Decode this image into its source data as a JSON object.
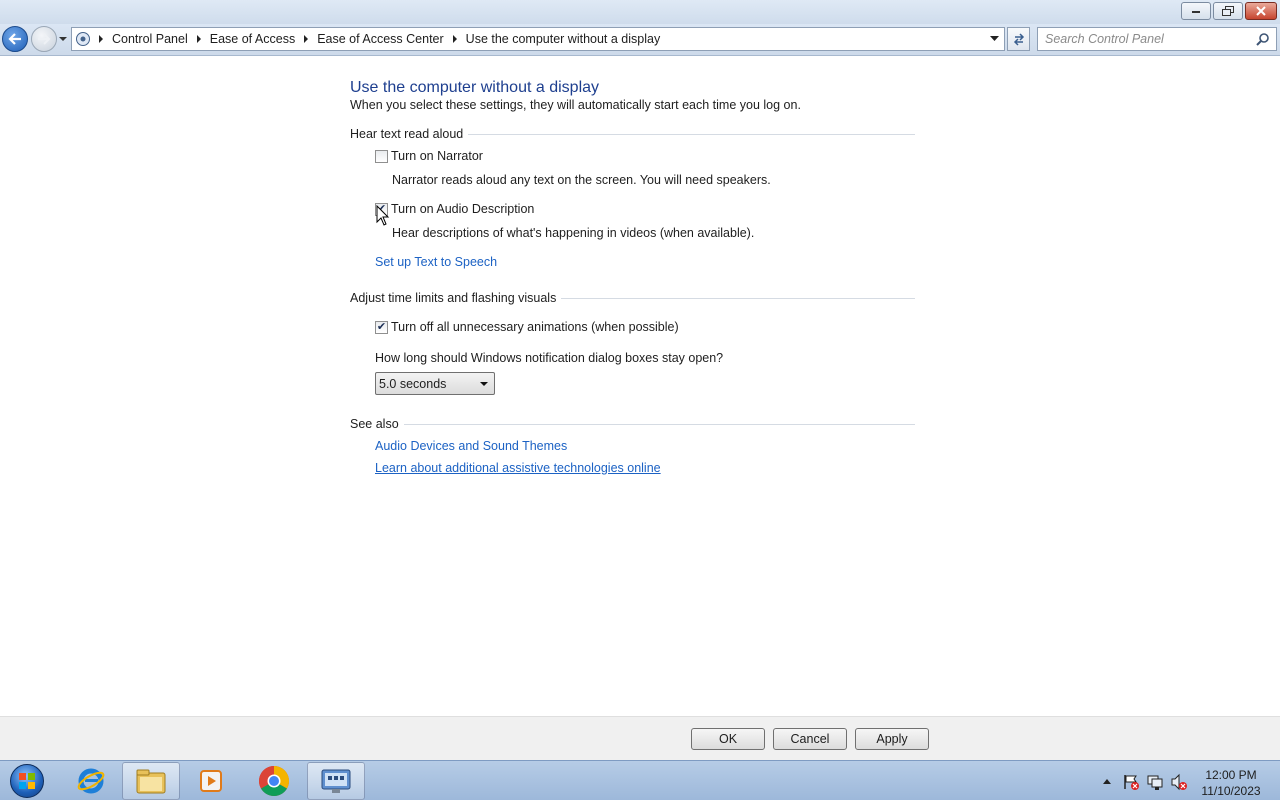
{
  "window": {
    "minimize_icon": "minimize-icon",
    "maximize_icon": "maximize-icon",
    "close_icon": "close-icon"
  },
  "address_bar": {
    "breadcrumbs": [
      "Control Panel",
      "Ease of Access",
      "Ease of Access Center",
      "Use the computer without a display"
    ],
    "search_placeholder": "Search Control Panel"
  },
  "page": {
    "title": "Use the computer without a display",
    "subtitle": "When you select these settings, they will automatically start each time you log on.",
    "sections": {
      "hear": {
        "heading": "Hear text read aloud",
        "narrator": {
          "label": "Turn on Narrator",
          "checked": false,
          "description": "Narrator reads aloud any text on the screen. You will need speakers."
        },
        "audio_description": {
          "label": "Turn on Audio Description",
          "checked": true,
          "description": "Hear descriptions of what's happening in videos (when available)."
        },
        "tts_link": "Set up Text to Speech"
      },
      "time": {
        "heading": "Adjust time limits and flashing visuals",
        "animations": {
          "label": "Turn off all unnecessary animations (when possible)",
          "checked": true
        },
        "dialog_question": "How long should Windows notification dialog boxes stay open?",
        "dialog_value": "5.0 seconds"
      },
      "see_also": {
        "heading": "See also",
        "links": [
          "Audio Devices and Sound Themes",
          "Learn about additional assistive technologies online"
        ]
      }
    }
  },
  "buttons": {
    "ok": "OK",
    "cancel": "Cancel",
    "apply": "Apply"
  },
  "taskbar": {
    "apps": [
      "start-orb",
      "internet-explorer",
      "file-explorer",
      "media-player",
      "chrome",
      "control-panel"
    ],
    "clock": {
      "time": "12:00 PM",
      "date": "11/10/2023"
    }
  },
  "colors": {
    "link": "#1c62c4",
    "title": "#1e3f8f"
  }
}
